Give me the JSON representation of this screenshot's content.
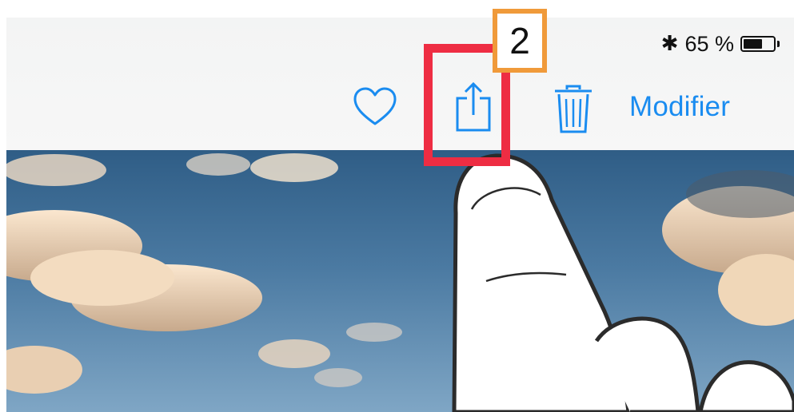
{
  "status_bar": {
    "bluetooth_symbol": "✱",
    "battery_text": "65 %",
    "battery_level": 0.65
  },
  "toolbar": {
    "favorite_icon": "heart-icon",
    "share_icon": "share-icon",
    "delete_icon": "trash-icon",
    "edit_label": "Modifier"
  },
  "annotation": {
    "step_number": "2",
    "highlight_color": "#ee2d43",
    "badge_color": "#f09a3a",
    "accent_color": "#1a8cf0"
  }
}
